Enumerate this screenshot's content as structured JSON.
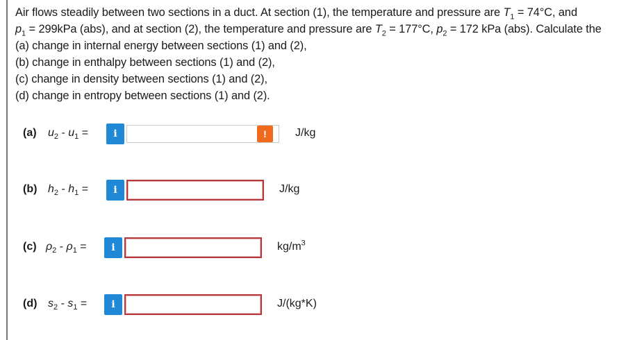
{
  "problem": {
    "line1_a": "Air flows steadily between two sections in a duct. At section (1), the temperature and pressure are ",
    "t1_var": "T",
    "t1_sub": "1",
    "line1_b": " = 74°C, and",
    "p1_var": "p",
    "p1_sub": "1",
    "line2_a": " = 299kPa (abs), and at section (2), the temperature and pressure are ",
    "t2_var": "T",
    "t2_sub": "2",
    "line2_b": " = 177°C, ",
    "p2_var": "p",
    "p2_sub": "2",
    "line2_c": " = 172 kPa (abs). Calculate the",
    "part_a": "(a) change in internal energy between sections (1) and (2),",
    "part_b": "(b) change in enthalpy between sections (1) and (2),",
    "part_c": "(c) change in density between sections (1) and (2),",
    "part_d": "(d) change in entropy between sections (1) and (2)."
  },
  "answers": [
    {
      "label": "(a)",
      "lhs": "u",
      "sub2": "2",
      "op": " - ",
      "rhs": "u",
      "sub1": "1",
      "eq": " =",
      "info": "i",
      "value": "",
      "warning": "!",
      "unit": "J/kg"
    },
    {
      "label": "(b)",
      "lhs": "h",
      "sub2": "2",
      "op": " - ",
      "rhs": "h",
      "sub1": "1",
      "eq": " =",
      "info": "i",
      "value": "",
      "unit": "J/kg"
    },
    {
      "label": "(c)",
      "lhs": "ρ",
      "sub2": "2",
      "op": " - ",
      "rhs": "ρ",
      "sub1": "1",
      "eq": " =",
      "info": "i",
      "value": "",
      "unit_base": "kg/m",
      "unit_sup": "3"
    },
    {
      "label": "(d)",
      "lhs": "s",
      "sub2": "2",
      "op": " - ",
      "rhs": "s",
      "sub1": "1",
      "eq": " =",
      "info": "i",
      "value": "",
      "unit": "J/(kg*K)"
    }
  ],
  "colors": {
    "info_button": "#1f89d8",
    "error_border": "#b7383a",
    "warning_badge": "#f06a1d"
  }
}
